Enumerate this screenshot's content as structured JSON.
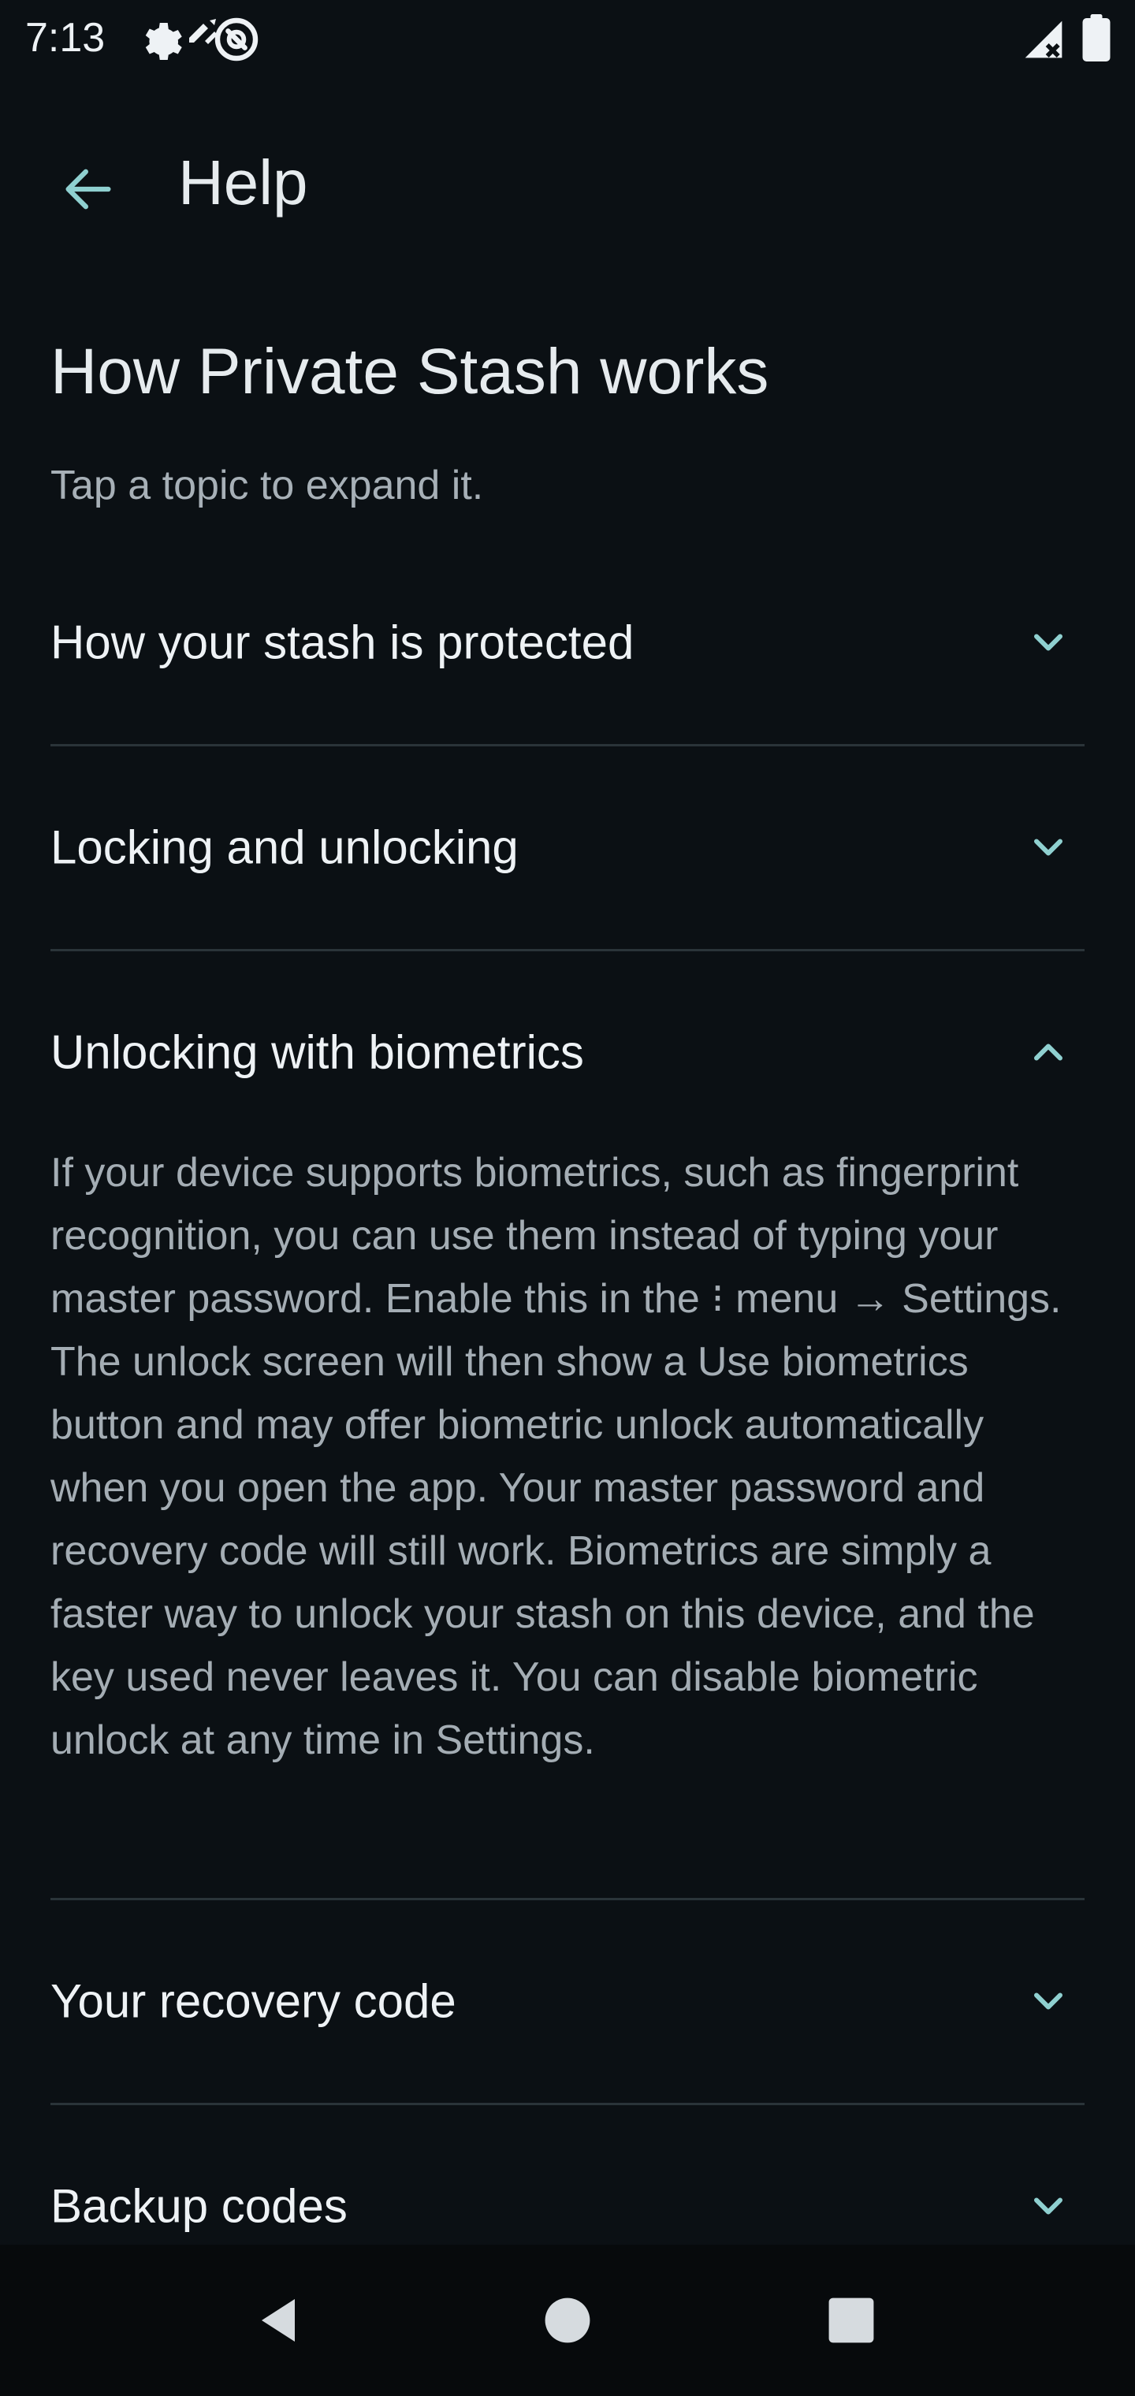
{
  "status_bar": {
    "time": "7:13",
    "icons": [
      "settings-icon",
      "privacy-indicator-icon",
      "sync-icon",
      "signal-icon",
      "battery-icon"
    ]
  },
  "app_bar": {
    "back_icon": "arrow-back-icon",
    "title": "Help"
  },
  "page": {
    "heading": "How Private Stash works",
    "subtitle": "Tap a topic to expand it.",
    "sections": [
      {
        "title": "How your stash is protected",
        "expanded": false
      },
      {
        "title": "Locking and unlocking",
        "expanded": false
      },
      {
        "title": "Unlocking with biometrics",
        "expanded": true,
        "body": {
          "part1": "If your device supports biometrics, such as fingerprint recognition, you can use them instead of typing your master password. Enable this in the ",
          "menu_glyph": "⁝",
          "part2": " menu → Settings. The unlock screen will then show a Use biometrics button and may offer biometric unlock automatically when you open the app. Your master password and recovery code will still work. Biometrics are simply a faster way to unlock your stash on this device, and the key used never leaves it. You can disable biometric unlock at any time in Settings."
        }
      },
      {
        "title": "Your recovery code",
        "expanded": false
      },
      {
        "title": "Backup codes",
        "expanded": false
      }
    ]
  },
  "nav_bar": {
    "back": "nav-back-icon",
    "home": "nav-home-icon",
    "recents": "nav-recents-icon"
  },
  "colors": {
    "background": "#0b1014",
    "accent": "#8fd0d0",
    "divider": "#2a3439",
    "body_text": "#a4adb4"
  }
}
